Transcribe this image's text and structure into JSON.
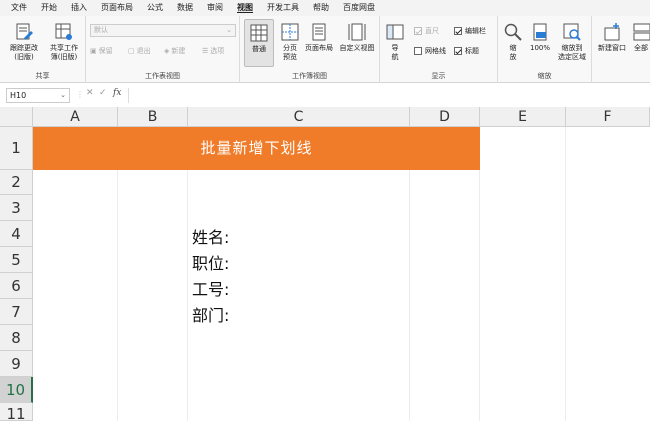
{
  "menu": {
    "tabs": [
      "文件",
      "开始",
      "插入",
      "页面布局",
      "公式",
      "数据",
      "审阅",
      "视图",
      "开发工具",
      "帮助",
      "百度网盘"
    ],
    "active": "视图"
  },
  "ribbon": {
    "share_group": {
      "label": "共享",
      "track_changes": "跟踪更改\n(旧版)",
      "share_workbook": "共享工作\n簿(旧版)"
    },
    "sheet_view_group": {
      "label": "工作表视图",
      "default_select": "默认",
      "keep": "保留",
      "exit": "退出",
      "new": "新建",
      "options": "选项"
    },
    "workbook_views_group": {
      "label": "工作簿视图",
      "normal": "普通",
      "page_break": "分页\n预览",
      "page_layout": "页面布局",
      "custom_views": "自定义视图"
    },
    "show_group": {
      "label": "显示",
      "navigation": "导\n航",
      "ruler": "直尺",
      "formula_bar": "编辑栏",
      "gridlines": "网格线",
      "headings": "标题"
    },
    "zoom_group": {
      "label": "缩放",
      "zoom": "缩\n放",
      "zoom100": "100%",
      "zoom_selection": "缩放到\n选定区域"
    },
    "window_group": {
      "new_window": "新建窗口",
      "arrange_all": "全部"
    }
  },
  "formula_bar": {
    "name_box": "H10",
    "fx": "fx",
    "value": ""
  },
  "sheet": {
    "columns": [
      "A",
      "B",
      "C",
      "D",
      "E",
      "F"
    ],
    "rows": [
      "1",
      "2",
      "3",
      "4",
      "5",
      "6",
      "7",
      "8",
      "9",
      "10",
      "11"
    ],
    "selected_row": "10",
    "title": "批量新增下划线",
    "labels": [
      "姓名:",
      "职位:",
      "工号:",
      "部门:"
    ]
  },
  "colors": {
    "accent_orange": "#f07c2a",
    "excel_green": "#217346"
  }
}
